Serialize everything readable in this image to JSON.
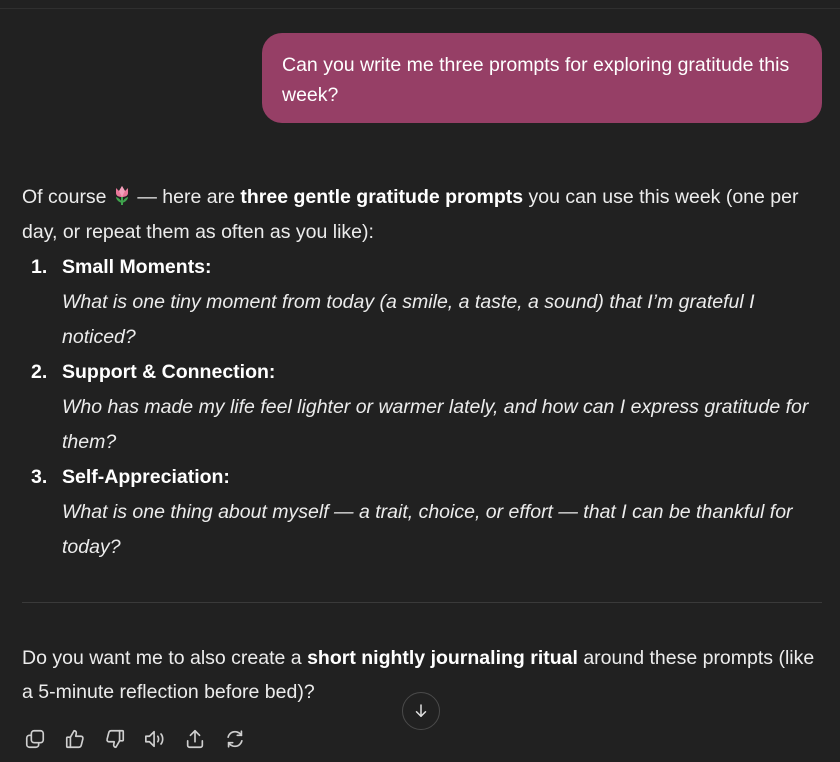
{
  "conversation": {
    "user_message": "Can you write me three prompts for exploring gratitude this week?",
    "assistant": {
      "intro_prefix": "Of course",
      "intro_emoji": "tulip-emoji",
      "intro_dash": " — here are ",
      "intro_bold": "three gentle gratitude prompts",
      "intro_suffix": " you can use this week (one per day, or repeat them as often as you like):",
      "prompts": [
        {
          "number": "1.",
          "title": "Small Moments:",
          "text": "What is one tiny moment from today (a smile, a taste, a sound) that I’m grateful I noticed?"
        },
        {
          "number": "2.",
          "title": "Support & Connection:",
          "text": "Who has made my life feel lighter or warmer lately, and how can I express gratitude for them?"
        },
        {
          "number": "3.",
          "title": "Self-Appreciation:",
          "text": "What is one thing about myself — a trait, choice, or effort — that I can be thankful for today?"
        }
      ],
      "followup_prefix": "Do you want me to also create a ",
      "followup_bold": "short nightly journaling ritual",
      "followup_suffix": " around these prompts (like a 5-minute reflection before bed)?"
    }
  },
  "actions": [
    {
      "name": "copy-icon"
    },
    {
      "name": "thumbs-up-icon"
    },
    {
      "name": "thumbs-down-icon"
    },
    {
      "name": "read-aloud-icon"
    },
    {
      "name": "share-icon"
    },
    {
      "name": "regenerate-icon"
    }
  ],
  "scroll_button": {
    "icon": "arrow-down-icon"
  },
  "colors": {
    "background": "#212121",
    "user_bubble": "#963f66",
    "text": "#ececec",
    "icon": "#cfcfcf"
  }
}
